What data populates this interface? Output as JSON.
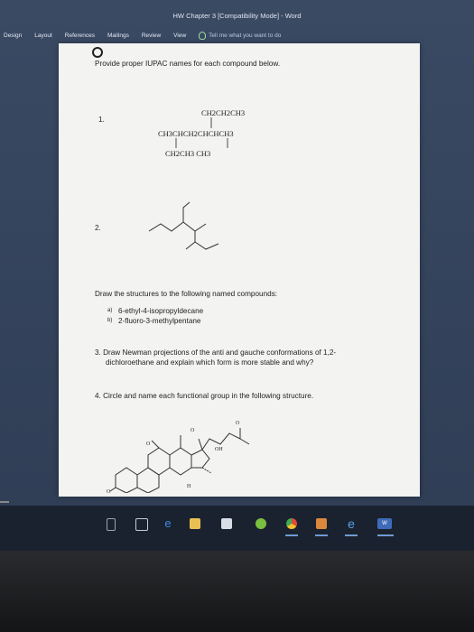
{
  "window": {
    "title": "HW Chapter 3 [Compatibility Mode] - Word"
  },
  "ribbon": {
    "tabs": [
      "Design",
      "Layout",
      "References",
      "Mailings",
      "Review",
      "View"
    ],
    "tell_me": "Tell me what you want to do"
  },
  "document": {
    "instruction_1": "Provide proper IUPAC names for each compound below.",
    "q1": {
      "number": "1.",
      "line1": "CH2CH2CH3",
      "line2": "CH3CHCH2CHCHCH3",
      "line3": "CH2CH3   CH3"
    },
    "q2": {
      "number": "2."
    },
    "instruction_2": "Draw the structures to the following named compounds:",
    "item_a_marker": "a)",
    "item_a": "6-ethyl-4-isopropyldecane",
    "item_b_marker": "b)",
    "item_b": "2-fluoro-3-methylpentane",
    "q3_line1": "3. Draw Newman projections of the anti and gauche conformations of 1,2-",
    "q3_line2": "dichloroethane and explain which form is more stable and why?",
    "q4": "4. Circle and name each functional group in the following structure.",
    "struct_labels": {
      "oh": "OH",
      "h": "H",
      "o1": "O",
      "o2": "O",
      "o3": "O",
      "o4": "O"
    }
  },
  "taskbar": {
    "icons": [
      "task-view-icon",
      "edge-icon",
      "file-explorer-icon",
      "store-icon",
      "spotify-icon",
      "chrome-icon",
      "app-icon",
      "ie-icon",
      "word-icon"
    ],
    "word_label": "W"
  }
}
